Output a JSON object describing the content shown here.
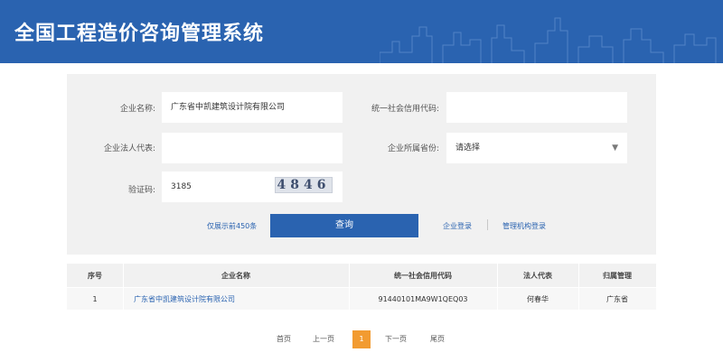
{
  "header": {
    "title": "全国工程造价咨询管理系统"
  },
  "form": {
    "company_name_label": "企业名称:",
    "company_name_value": "广东省中凯建筑设计院有限公司",
    "credit_code_label": "统一社会信用代码:",
    "credit_code_value": "",
    "legal_rep_label": "企业法人代表:",
    "legal_rep_value": "",
    "province_label": "企业所属省份:",
    "province_selected": "请选择",
    "captcha_label": "验证码:",
    "captcha_input_value": "3185",
    "captcha_image_text": "4846"
  },
  "actions": {
    "limit_note": "仅展示前450条",
    "query_button": "查询",
    "company_login": "企业登录",
    "agency_login": "管理机构登录"
  },
  "table": {
    "columns": [
      "序号",
      "企业名称",
      "统一社会信用代码",
      "法人代表",
      "归属管理"
    ],
    "rows": [
      [
        "1",
        "广东省中凯建筑设计院有限公司",
        "91440101MA9W1QEQ03",
        "何春华",
        "广东省"
      ]
    ]
  },
  "pagination": {
    "first": "首页",
    "prev": "上一页",
    "current": "1",
    "next": "下一页",
    "last": "尾页"
  },
  "colors": {
    "brand_blue": "#2a63b0",
    "active_page": "#f29b31",
    "panel_bg": "#f1f1f1"
  }
}
